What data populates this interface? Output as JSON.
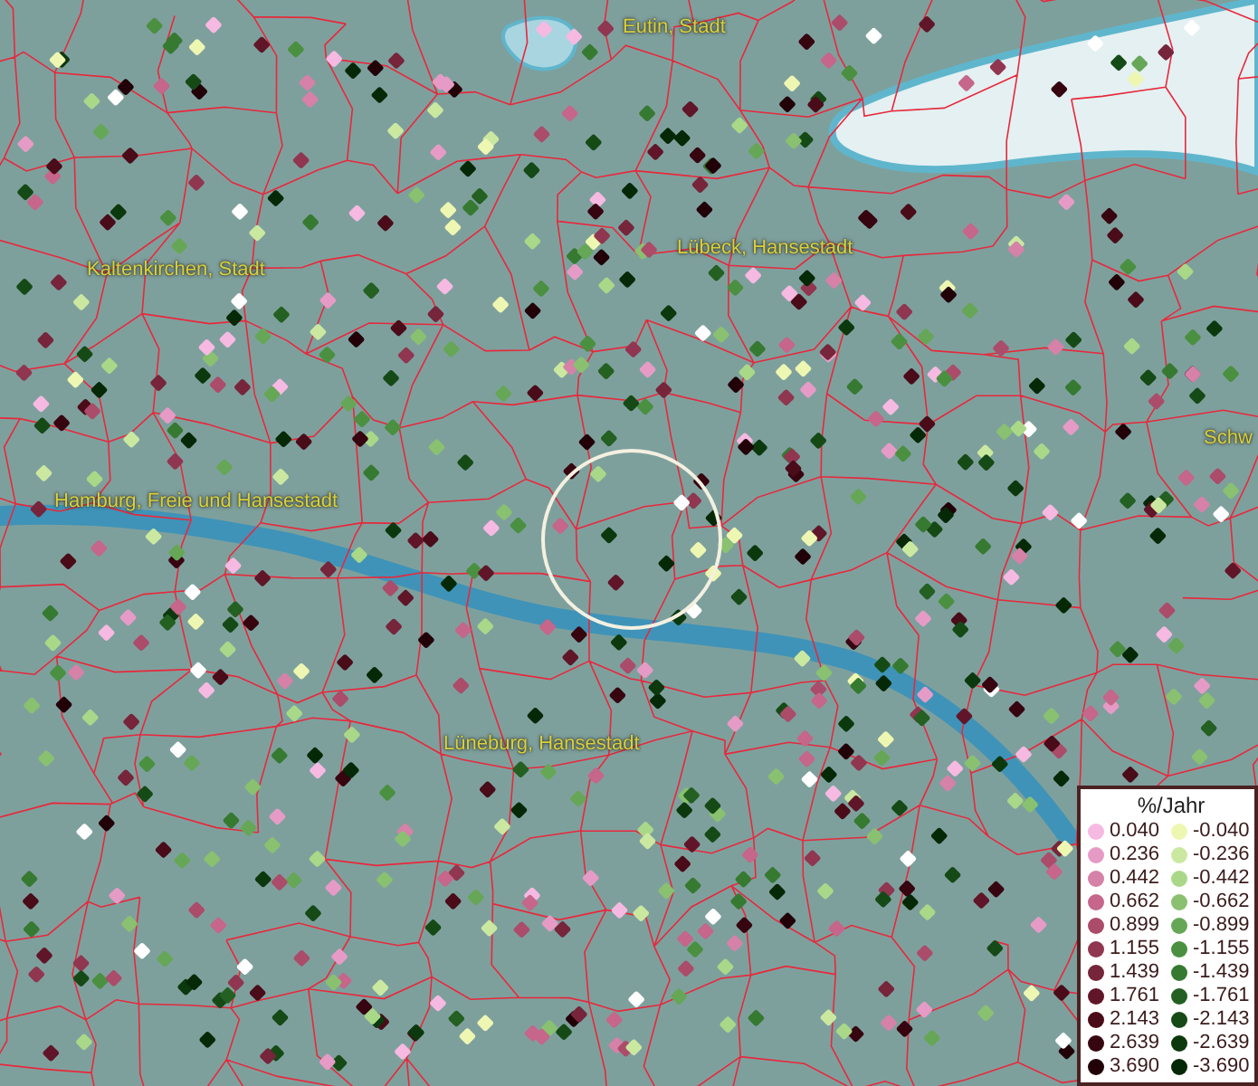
{
  "places": [
    {
      "name": "Eutin, Stadt"
    },
    {
      "name": "Kaltenkirchen, Stadt"
    },
    {
      "name": "Lübeck, Hansestadt"
    },
    {
      "name": "Schw"
    },
    {
      "name": "Hamburg, Freie und Hansestadt"
    },
    {
      "name": "Lüneburg, Hansestadt"
    }
  ],
  "legend": {
    "title": "%/Jahr",
    "positive": [
      {
        "label": "0.040",
        "color": "#f6b9e2"
      },
      {
        "label": "0.236",
        "color": "#e69bc6"
      },
      {
        "label": "0.442",
        "color": "#d681a8"
      },
      {
        "label": "0.662",
        "color": "#c5668a"
      },
      {
        "label": "0.899",
        "color": "#ab4c6a"
      },
      {
        "label": "1.155",
        "color": "#903650"
      },
      {
        "label": "1.439",
        "color": "#76253b"
      },
      {
        "label": "1.761",
        "color": "#601628"
      },
      {
        "label": "2.143",
        "color": "#4a0c19"
      },
      {
        "label": "2.639",
        "color": "#360510"
      },
      {
        "label": "3.690",
        "color": "#210008"
      }
    ],
    "negative": [
      {
        "label": "-0.040",
        "color": "#eef7b2"
      },
      {
        "label": "-0.236",
        "color": "#cbe8a0"
      },
      {
        "label": "-0.442",
        "color": "#a9d888"
      },
      {
        "label": "-0.662",
        "color": "#89c170"
      },
      {
        "label": "-0.899",
        "color": "#66a757"
      },
      {
        "label": "-1.155",
        "color": "#4a9040"
      },
      {
        "label": "-1.439",
        "color": "#367a31"
      },
      {
        "label": "-1.761",
        "color": "#236022"
      },
      {
        "label": "-2.143",
        "color": "#154a16"
      },
      {
        "label": "-2.639",
        "color": "#0c380d"
      },
      {
        "label": "-3.690",
        "color": "#052806"
      }
    ]
  }
}
